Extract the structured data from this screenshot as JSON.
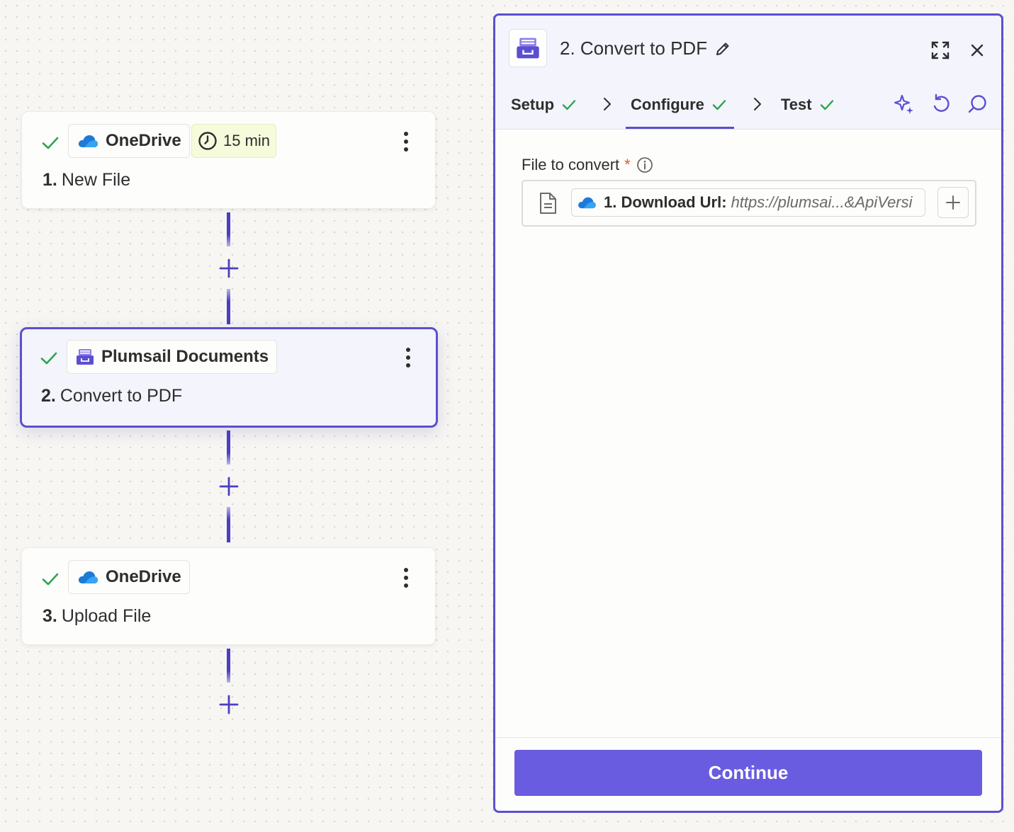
{
  "colors": {
    "accent": "#5b4fd0",
    "button": "#6a5ce0",
    "success": "#2ea44f",
    "required": "#e0572a",
    "time_chip_bg": "#f6fbdc"
  },
  "workflow": {
    "steps": [
      {
        "app": "OneDrive",
        "app_icon": "onedrive-cloud-icon",
        "status_icon": "check-icon",
        "number": "1.",
        "title": "New File",
        "interval": "15 min",
        "interval_icon": "clock-icon",
        "selected": false
      },
      {
        "app": "Plumsail Documents",
        "app_icon": "plumsail-documents-icon",
        "status_icon": "check-icon",
        "number": "2.",
        "title": "Convert to PDF",
        "selected": true
      },
      {
        "app": "OneDrive",
        "app_icon": "onedrive-cloud-icon",
        "status_icon": "check-icon",
        "number": "3.",
        "title": "Upload File",
        "selected": false
      }
    ]
  },
  "panel": {
    "title": "2. Convert to PDF",
    "tabs": [
      {
        "label": "Setup",
        "status_icon": "check-icon"
      },
      {
        "label": "Configure",
        "status_icon": "check-icon",
        "active": true
      },
      {
        "label": "Test",
        "status_icon": "check-icon"
      }
    ],
    "field": {
      "label": "File to convert",
      "required_mark": "*",
      "value_label": "1. Download Url:",
      "value_text": "https://plumsai...&ApiVersi"
    },
    "continue_label": "Continue"
  }
}
